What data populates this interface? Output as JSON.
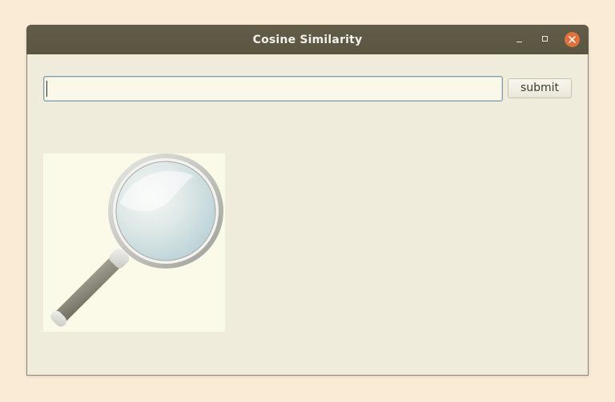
{
  "window": {
    "title": "Cosine Similarity"
  },
  "search": {
    "value": "",
    "placeholder": ""
  },
  "submit": {
    "label": "submit"
  },
  "image": {
    "icon": "magnifier-icon"
  },
  "colors": {
    "desktop": "#faebd7",
    "titlebar": "#5e5945",
    "window_bg": "#f0ecdb",
    "close_button": "#e2703a",
    "input_border": "#7f9db3"
  }
}
